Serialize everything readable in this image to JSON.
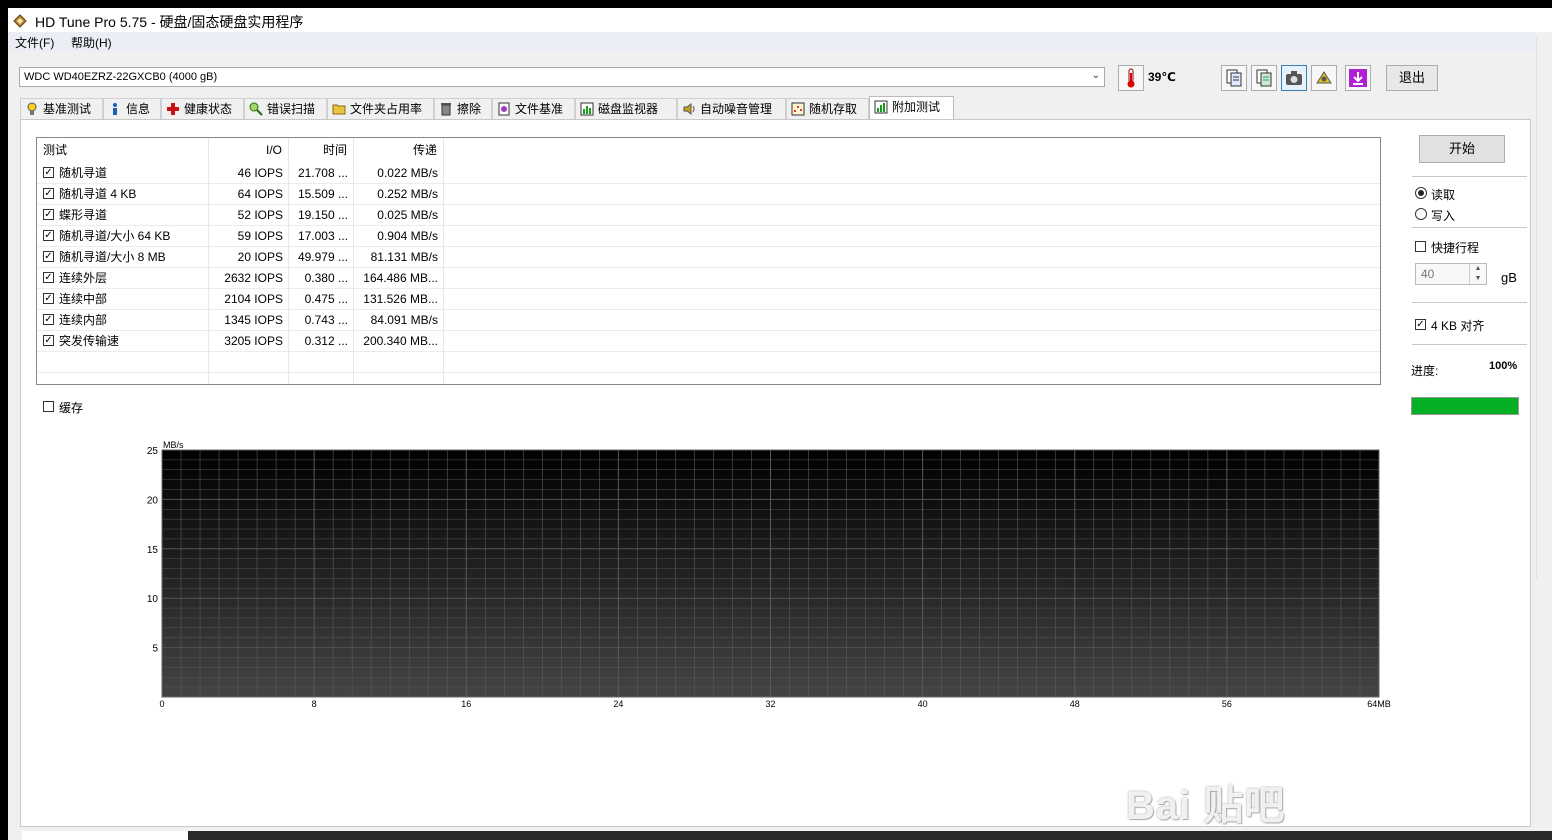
{
  "window": {
    "title": "HD Tune Pro 5.75 - 硬盘/固态硬盘实用程序"
  },
  "menu": {
    "items": [
      "文件(F)",
      "帮助(H)"
    ]
  },
  "toolbar": {
    "drive": "WDC WD40EZRZ-22GXCB0 (4000 gB)",
    "temperature": "39℃",
    "exit_label": "退出",
    "icons": [
      "copy-info-icon",
      "copy-all-icon",
      "screenshot-camera-icon",
      "options-icon",
      "save-down-icon"
    ]
  },
  "tabs": [
    {
      "label": "基准测试",
      "icon": "lightbulb-icon"
    },
    {
      "label": "信息",
      "icon": "info-icon"
    },
    {
      "label": "健康状态",
      "icon": "health-cross-icon"
    },
    {
      "label": "错误扫描",
      "icon": "magnifier-icon"
    },
    {
      "label": "文件夹占用率",
      "icon": "folder-icon"
    },
    {
      "label": "擦除",
      "icon": "trash-icon"
    },
    {
      "label": "文件基准",
      "icon": "file-benchmark-icon"
    },
    {
      "label": "磁盘监视器",
      "icon": "disk-monitor-icon"
    },
    {
      "label": "自动噪音管理",
      "icon": "speaker-icon"
    },
    {
      "label": "随机存取",
      "icon": "random-access-icon"
    },
    {
      "label": "附加测试",
      "icon": "extra-tests-icon",
      "active": true
    }
  ],
  "table": {
    "headers": {
      "test": "测试",
      "io": "I/O",
      "time": "时间",
      "transfer": "传递"
    },
    "rows": [
      {
        "test": "随机寻道",
        "io": "46 IOPS",
        "time": "21.708 ...",
        "transfer": "0.022 MB/s"
      },
      {
        "test": "随机寻道 4 KB",
        "io": "64 IOPS",
        "time": "15.509 ...",
        "transfer": "0.252 MB/s"
      },
      {
        "test": "蝶形寻道",
        "io": "52 IOPS",
        "time": "19.150 ...",
        "transfer": "0.025 MB/s"
      },
      {
        "test": "随机寻道/大小 64 KB",
        "io": "59 IOPS",
        "time": "17.003 ...",
        "transfer": "0.904 MB/s"
      },
      {
        "test": "随机寻道/大小 8 MB",
        "io": "20 IOPS",
        "time": "49.979 ...",
        "transfer": "81.131 MB/s"
      },
      {
        "test": "连续外层",
        "io": "2632 IOPS",
        "time": "0.380 ...",
        "transfer": "164.486 MB..."
      },
      {
        "test": "连续中部",
        "io": "2104 IOPS",
        "time": "0.475 ...",
        "transfer": "131.526 MB..."
      },
      {
        "test": "连续内部",
        "io": "1345 IOPS",
        "time": "0.743 ...",
        "transfer": "84.091 MB/s"
      },
      {
        "test": "突发传输速",
        "io": "3205 IOPS",
        "time": "0.312 ...",
        "transfer": "200.340 MB..."
      }
    ]
  },
  "cache": {
    "label": "缓存",
    "checked": false
  },
  "side": {
    "start_label": "开始",
    "read_label": "读取",
    "write_label": "写入",
    "mode": "read",
    "quick_label": "快捷行程",
    "quick_checked": false,
    "spin_value": "40",
    "spin_unit": "gB",
    "align_label": "4 KB 对齐",
    "align_checked": true,
    "progress_label": "进度:",
    "progress_text": "100%",
    "progress": 1.0,
    "progress_color": "#06b025"
  },
  "chart_data": {
    "type": "line",
    "ylabel": "MB/s",
    "ylim": [
      0,
      25
    ],
    "yticks": [
      5,
      10,
      15,
      20,
      25
    ],
    "xlim": [
      0,
      64
    ],
    "xticks": [
      "0",
      "8",
      "16",
      "24",
      "32",
      "40",
      "48",
      "56",
      "64MB"
    ],
    "grid": true,
    "series": []
  },
  "watermark": "Bai  贴吧"
}
